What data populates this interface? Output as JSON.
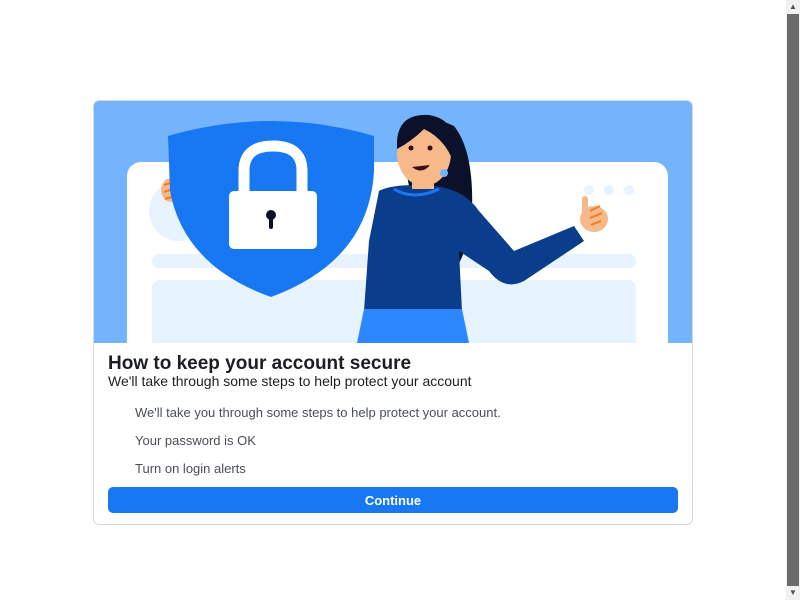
{
  "dialog": {
    "title": "How to keep your account secure",
    "subtitle": "We'll take through some steps to help protect your account",
    "items": [
      "We'll take you through some steps to help protect your account.",
      "Your password is OK",
      "Turn on login alerts"
    ],
    "continue_label": "Continue"
  },
  "colors": {
    "accent": "#1877f2",
    "hero_bg": "#74b4fc"
  }
}
